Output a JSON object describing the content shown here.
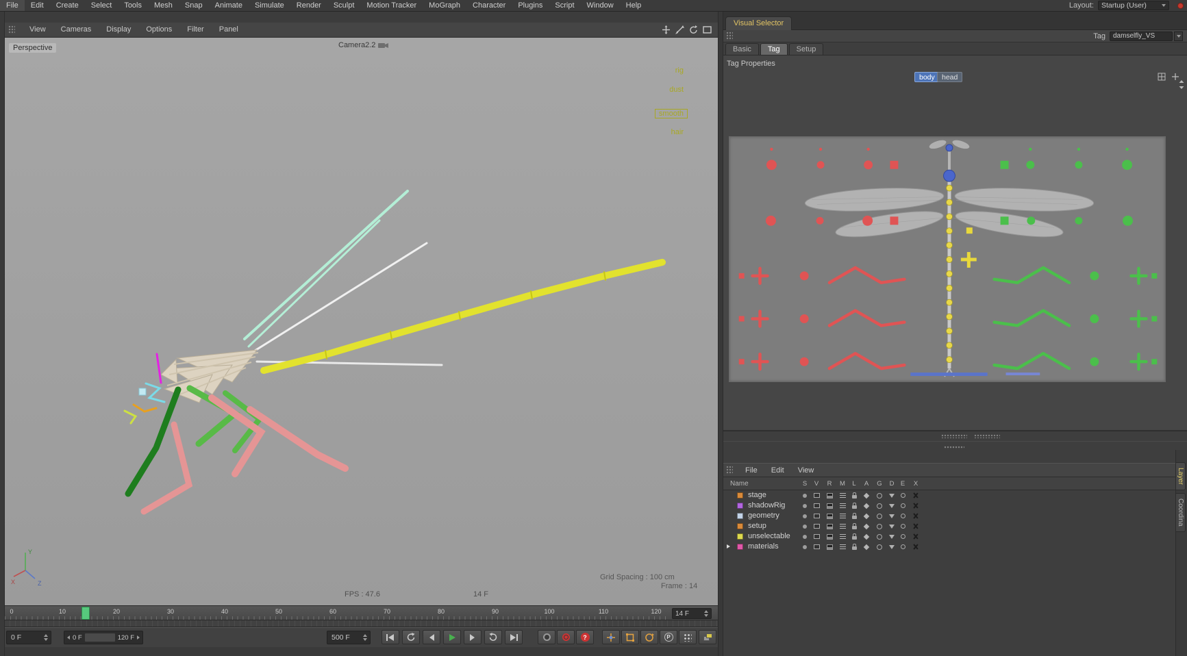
{
  "colors": {
    "accent_blue": "#4d74b8",
    "hud_yellow": "#a8a823",
    "play_green": "#49b04f",
    "record_red": "#cc3333",
    "marker_green": "#57c97d"
  },
  "menu_bar": {
    "items": [
      "File",
      "Edit",
      "Create",
      "Select",
      "Tools",
      "Mesh",
      "Snap",
      "Animate",
      "Simulate",
      "Render",
      "Sculpt",
      "Motion Tracker",
      "MoGraph",
      "Character",
      "Plugins",
      "Script",
      "Window",
      "Help"
    ],
    "layout_label": "Layout:",
    "layout_value": "Startup (User)"
  },
  "viewport": {
    "menu": [
      "View",
      "Cameras",
      "Display",
      "Options",
      "Filter",
      "Panel"
    ],
    "view_label": "Perspective",
    "camera_label": "Camera2.2",
    "hud_labels": [
      "rig",
      "dust",
      "smooth",
      "hair"
    ],
    "grid_spacing": "Grid Spacing : 100 cm",
    "frame_text": "Frame : 14",
    "fps_text": "FPS : 47.6",
    "frame_badge": "14 F",
    "axis": {
      "x": "X",
      "y": "Y",
      "z": "Z"
    }
  },
  "timeline": {
    "ticks": [
      "0",
      "10",
      "20",
      "30",
      "40",
      "50",
      "60",
      "70",
      "80",
      "90",
      "100",
      "110",
      "120"
    ],
    "current_frame_field": "14 F",
    "start_field": "0 F",
    "range_start": "0 F",
    "range_end": "120 F",
    "end_field": "500 F"
  },
  "visual_selector": {
    "panel_title": "Visual Selector",
    "tag_label": "Tag",
    "tag_value": "damselfly_VS",
    "tabs": [
      "Basic",
      "Tag",
      "Setup"
    ],
    "active_tab": "Tag",
    "section_title": "Tag Properties",
    "body_label": "body",
    "head_label": "head"
  },
  "layer_browser": {
    "menu": [
      "File",
      "Edit",
      "View"
    ],
    "name_header": "Name",
    "columns": [
      "S",
      "V",
      "R",
      "M",
      "L",
      "A",
      "G",
      "D",
      "E",
      "X"
    ],
    "layers": [
      {
        "name": "stage",
        "color": "#d98a3a"
      },
      {
        "name": "shadowRig",
        "color": "#b266e0"
      },
      {
        "name": "geometry",
        "color": "#c3d3e8"
      },
      {
        "name": "setup",
        "color": "#d98a3a"
      },
      {
        "name": "unselectable",
        "color": "#ddd94e"
      },
      {
        "name": "materials",
        "color": "#e058a8"
      }
    ]
  },
  "side_rail": {
    "tabs": [
      "Layer",
      "Coordina"
    ]
  },
  "icons": {
    "parameter_glyph": "P",
    "question_glyph": "?"
  }
}
